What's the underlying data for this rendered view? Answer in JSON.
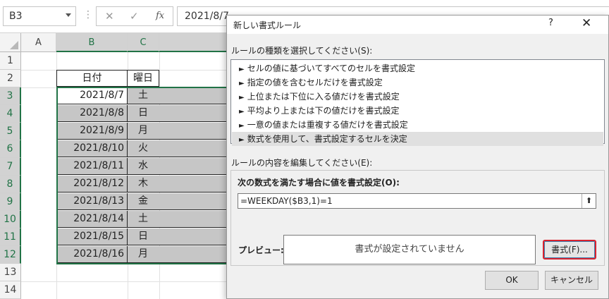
{
  "formula_bar": {
    "name_box": "B3",
    "cancel_icon": "✕",
    "enter_icon": "✓",
    "fx": "fx",
    "formula": "2021/8/7"
  },
  "grid": {
    "columns": [
      "A",
      "B",
      "C"
    ],
    "rows": [
      "1",
      "2",
      "3",
      "4",
      "5",
      "6",
      "7",
      "8",
      "9",
      "10",
      "11",
      "12",
      "13",
      "14"
    ],
    "header": {
      "date": "日付",
      "day": "曜日"
    },
    "data": [
      {
        "date": "2021/8/7",
        "day": "土"
      },
      {
        "date": "2021/8/8",
        "day": "日"
      },
      {
        "date": "2021/8/9",
        "day": "月"
      },
      {
        "date": "2021/8/10",
        "day": "火"
      },
      {
        "date": "2021/8/11",
        "day": "水"
      },
      {
        "date": "2021/8/12",
        "day": "木"
      },
      {
        "date": "2021/8/13",
        "day": "金"
      },
      {
        "date": "2021/8/14",
        "day": "土"
      },
      {
        "date": "2021/8/15",
        "day": "日"
      },
      {
        "date": "2021/8/16",
        "day": "月"
      }
    ]
  },
  "dialog": {
    "title": "新しい書式ルール",
    "help": "?",
    "close": "✕",
    "rule_type_label": "ルールの種類を選択してください(S):",
    "rule_types": [
      "セルの値に基づいてすべてのセルを書式設定",
      "指定の値を含むセルだけを書式設定",
      "上位または下位に入る値だけを書式設定",
      "平均より上または下の値だけを書式設定",
      "一意の値または重複する値だけを書式設定",
      "数式を使用して、書式設定するセルを決定"
    ],
    "rule_arrow": "►",
    "edit_label": "ルールの内容を編集してください(E):",
    "formula_label": "次の数式を満たす場合に値を書式設定(O):",
    "formula_value": "=WEEKDAY($B3,1)=1",
    "collapse_icon": "⬆",
    "preview_label": "プレビュー:",
    "preview_text": "書式が設定されていません",
    "format_button": "書式(F)...",
    "ok_button": "OK",
    "cancel_button": "キャンセル"
  },
  "colors": {
    "excel_green": "#217346",
    "selection_gray": "#c6c6c6",
    "focus_red": "#d9232f"
  }
}
